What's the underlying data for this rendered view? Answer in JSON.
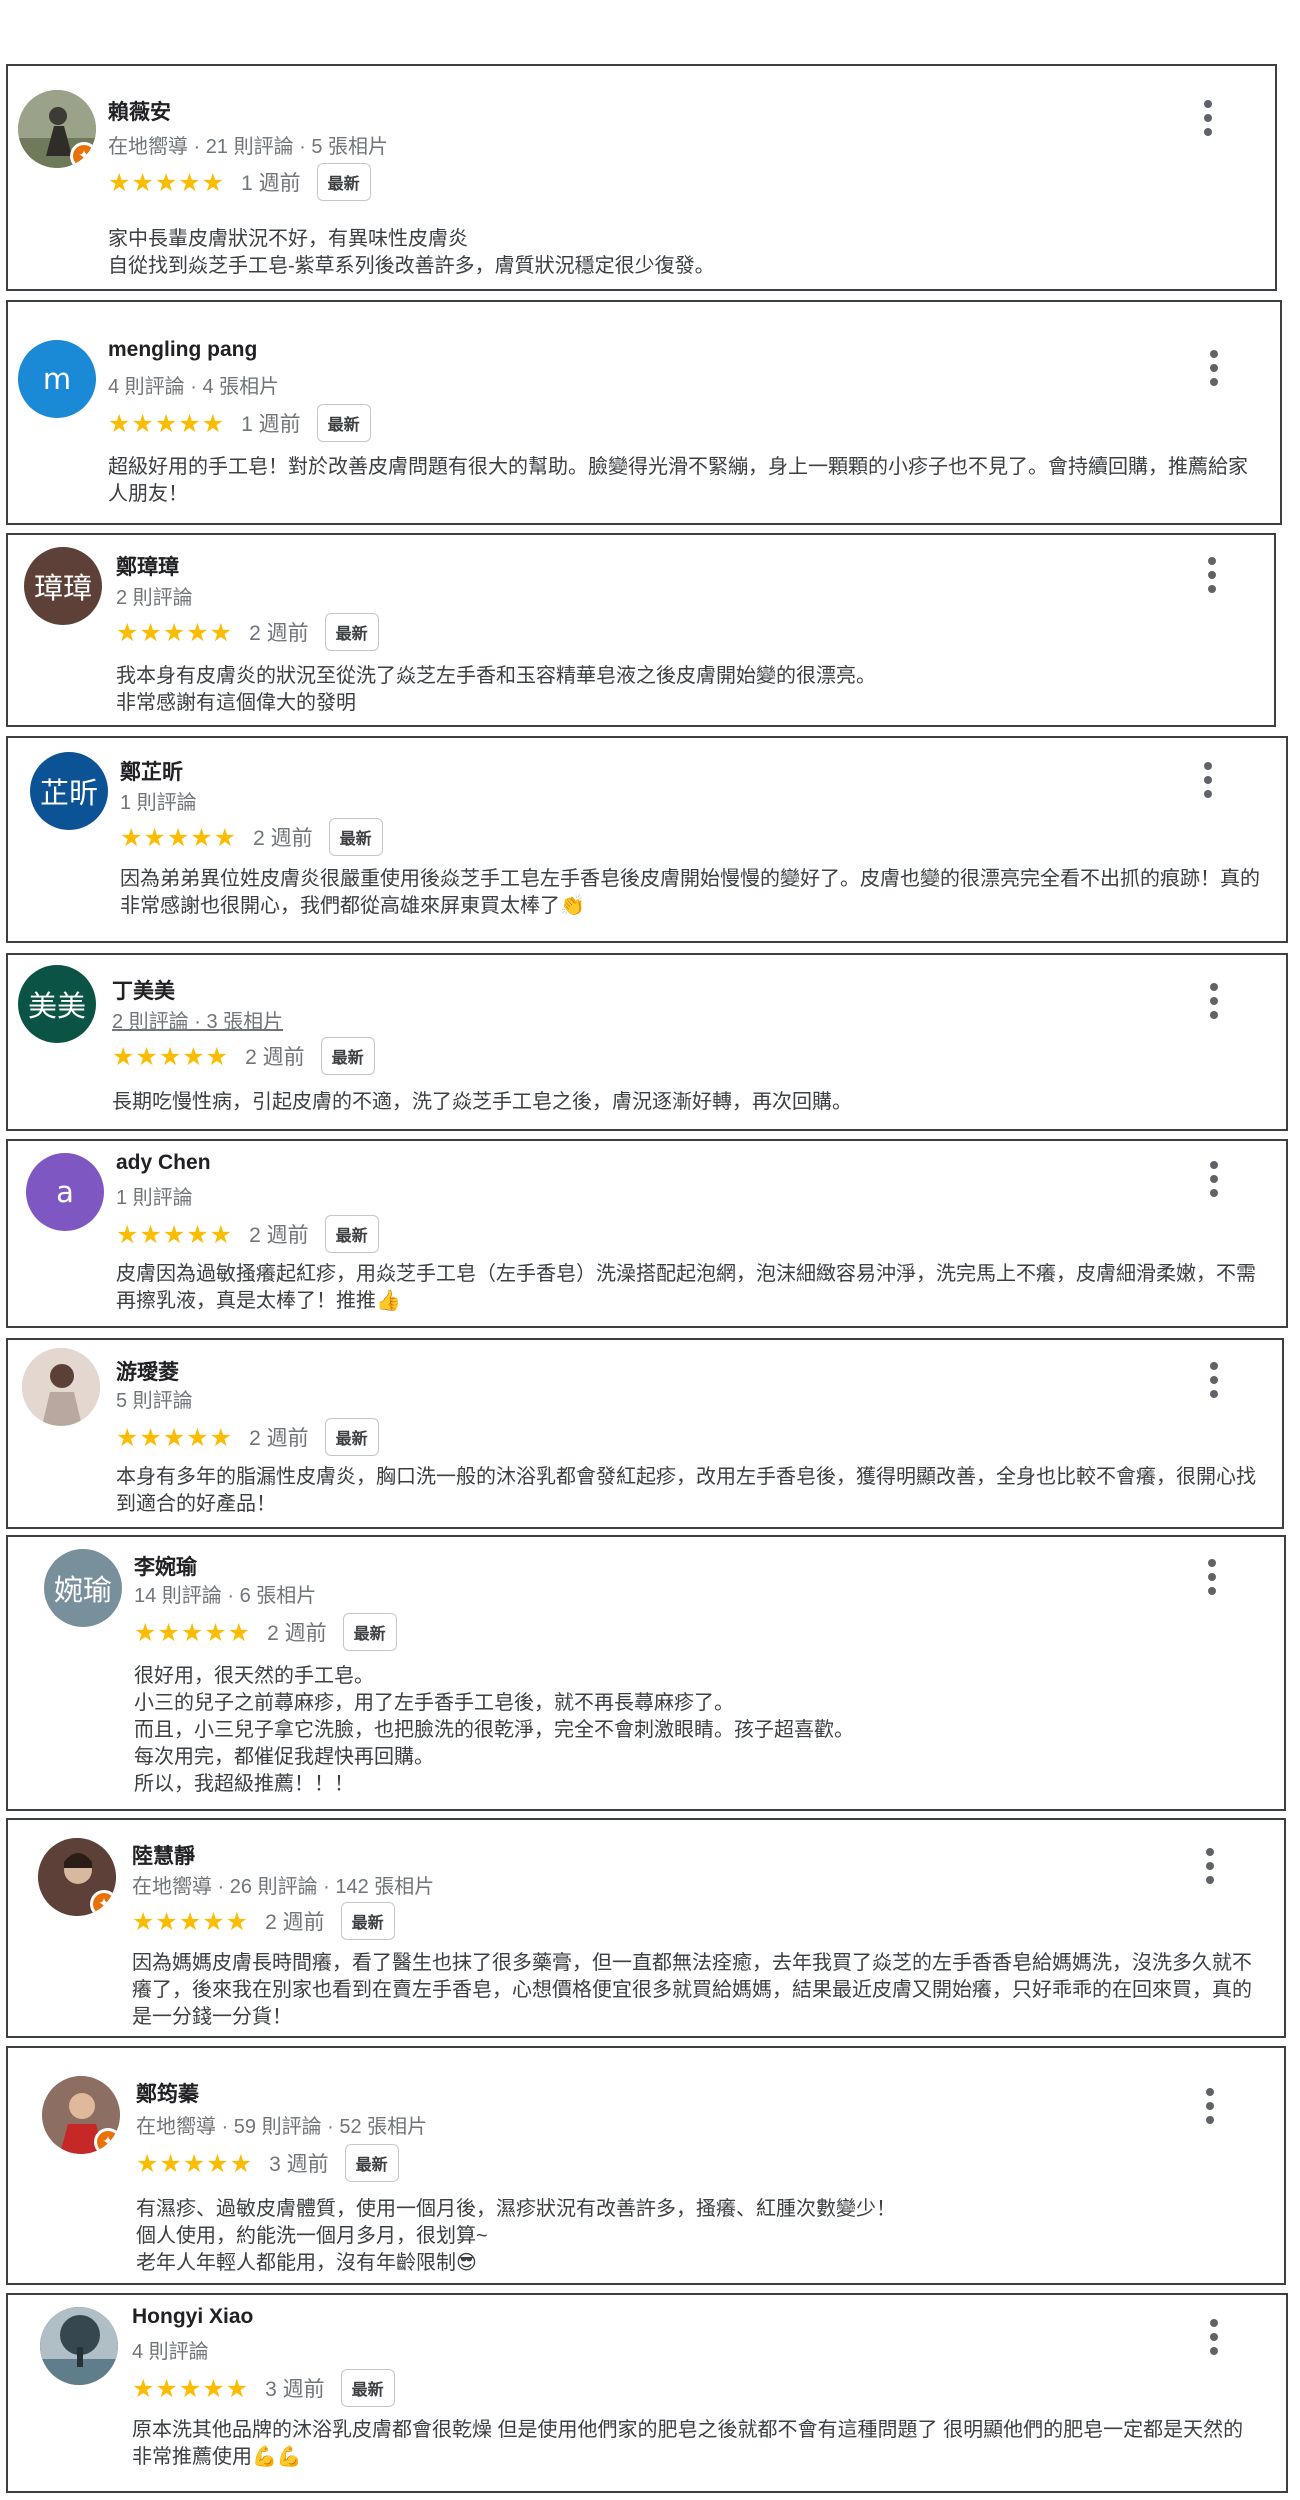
{
  "reviews": [
    {
      "name": "賴薇安",
      "meta": "在地嚮導 · 21 則評論 · 5 張相片",
      "stars": "★★★★★",
      "time": "1 週前",
      "badge": "最新",
      "avatar": {
        "type": "photo",
        "icon": "person-photo",
        "bg": "#8d8f7a",
        "local_guide": true
      },
      "text": "家中長輩皮膚狀況不好，有異味性皮膚炎\n自從找到焱芝手工皂-紫草系列後改善許多，膚質狀況穩定很少復發。"
    },
    {
      "name": "mengling pang",
      "meta": "4 則評論 · 4 張相片",
      "stars": "★★★★★",
      "time": "1 週前",
      "badge": "最新",
      "avatar": {
        "type": "letter",
        "letter": "m",
        "bg": "#1a8ad6"
      },
      "text": "超級好用的手工皂！對於改善皮膚問題有很大的幫助。臉變得光滑不緊繃，身上一顆顆的小疹子也不見了。會持續回購，推薦給家人朋友！"
    },
    {
      "name": "鄭璋璋",
      "meta": "2 則評論",
      "stars": "★★★★★",
      "time": "2 週前",
      "badge": "最新",
      "avatar": {
        "type": "letter",
        "letter": "璋璋",
        "bg": "#5d4037"
      },
      "text": "我本身有皮膚炎的狀況至從洗了焱芝左手香和玉容精華皂液之後皮膚開始變的很漂亮。\n非常感謝有這個偉大的發明"
    },
    {
      "name": "鄭芷昕",
      "meta": "1 則評論",
      "stars": "★★★★★",
      "time": "2 週前",
      "badge": "最新",
      "avatar": {
        "type": "letter",
        "letter": "芷昕",
        "bg": "#0b5394"
      },
      "text": "因為弟弟異位姓皮膚炎很嚴重使用後焱芝手工皂左手香皂後皮膚開始慢慢的變好了。皮膚也變的很漂亮完全看不出抓的痕跡！真的非常感謝也很開心，我們都從高雄來屏東買太棒了👏"
    },
    {
      "name": "丁美美",
      "meta": "2 則評論 · 3 張相片",
      "stars": "★★★★★",
      "time": "2 週前",
      "badge": "最新",
      "avatar": {
        "type": "letter",
        "letter": "美美",
        "bg": "#0b5345"
      },
      "text": "長期吃慢性病，引起皮膚的不適，洗了焱芝手工皂之後，膚況逐漸好轉，再次回購。"
    },
    {
      "name": "ady Chen",
      "meta": "1 則評論",
      "stars": "★★★★★",
      "time": "2 週前",
      "badge": "最新",
      "avatar": {
        "type": "letter",
        "letter": "a",
        "bg": "#7e57c2"
      },
      "text": "皮膚因為過敏搔癢起紅疹，用焱芝手工皂（左手香皂）洗澡搭配起泡網，泡沫細緻容易沖淨，洗完馬上不癢，皮膚細滑柔嫩，不需再擦乳液，真是太棒了！推推👍"
    },
    {
      "name": "游璦菱",
      "meta": "5 則評論",
      "stars": "★★★★★",
      "time": "2 週前",
      "badge": "最新",
      "avatar": {
        "type": "photo",
        "icon": "person-photo",
        "bg": "#d7c7bd",
        "local_guide": false
      },
      "text": "本身有多年的脂漏性皮膚炎，胸口洗一般的沐浴乳都會發紅起疹，改用左手香皂後，獲得明顯改善，全身也比較不會癢，很開心找到適合的好產品！"
    },
    {
      "name": "李婉瑜",
      "meta": "14 則評論 · 6 張相片",
      "stars": "★★★★★",
      "time": "2 週前",
      "badge": "最新",
      "avatar": {
        "type": "letter",
        "letter": "婉瑜",
        "bg": "#78909c"
      },
      "text": "很好用，很天然的手工皂。\n小三的兒子之前蕁麻疹，用了左手香手工皂後，就不再長蕁麻疹了。\n而且，小三兒子拿它洗臉，也把臉洗的很乾淨，完全不會刺激眼睛。孩子超喜歡。\n每次用完，都催促我趕快再回購。\n所以，我超級推薦！！！"
    },
    {
      "name": "陸慧靜",
      "meta": "在地嚮導 · 26 則評論 · 142 張相片",
      "stars": "★★★★★",
      "time": "2 週前",
      "badge": "最新",
      "avatar": {
        "type": "photo",
        "icon": "person-photo",
        "bg": "#6d4c41",
        "local_guide": true
      },
      "text": "因為媽媽皮膚長時間癢，看了醫生也抹了很多藥膏，但一直都無法痊癒，去年我買了焱芝的左手香香皂給媽媽洗，沒洗多久就不癢了，後來我在別家也看到在賣左手香皂，心想價格便宜很多就買給媽媽，結果最近皮膚又開始癢，只好乖乖的在回來買，真的是一分錢一分貨！"
    },
    {
      "name": "鄭筠蓁",
      "meta": "在地嚮導 · 59 則評論 · 52 張相片",
      "stars": "★★★★★",
      "time": "3 週前",
      "badge": "最新",
      "avatar": {
        "type": "photo",
        "icon": "person-photo",
        "bg": "#a1887f",
        "local_guide": true
      },
      "text": "有濕疹、過敏皮膚體質，使用一個月後，濕疹狀況有改善許多，搔癢、紅腫次數變少！\n個人使用，約能洗一個月多月，很划算~\n老年人年輕人都能用，沒有年齡限制😎"
    },
    {
      "name": "Hongyi Xiao",
      "meta": "4 則評論",
      "stars": "★★★★★",
      "time": "3 週前",
      "badge": "最新",
      "avatar": {
        "type": "photo",
        "icon": "tree-photo",
        "bg": "#546e7a",
        "local_guide": false
      },
      "text": "原本洗其他品牌的沐浴乳皮膚都會很乾燥 但是使用他們家的肥皂之後就都不會有這種問題了 很明顯他們的肥皂一定都是天然的 非常推薦使用💪💪"
    }
  ]
}
